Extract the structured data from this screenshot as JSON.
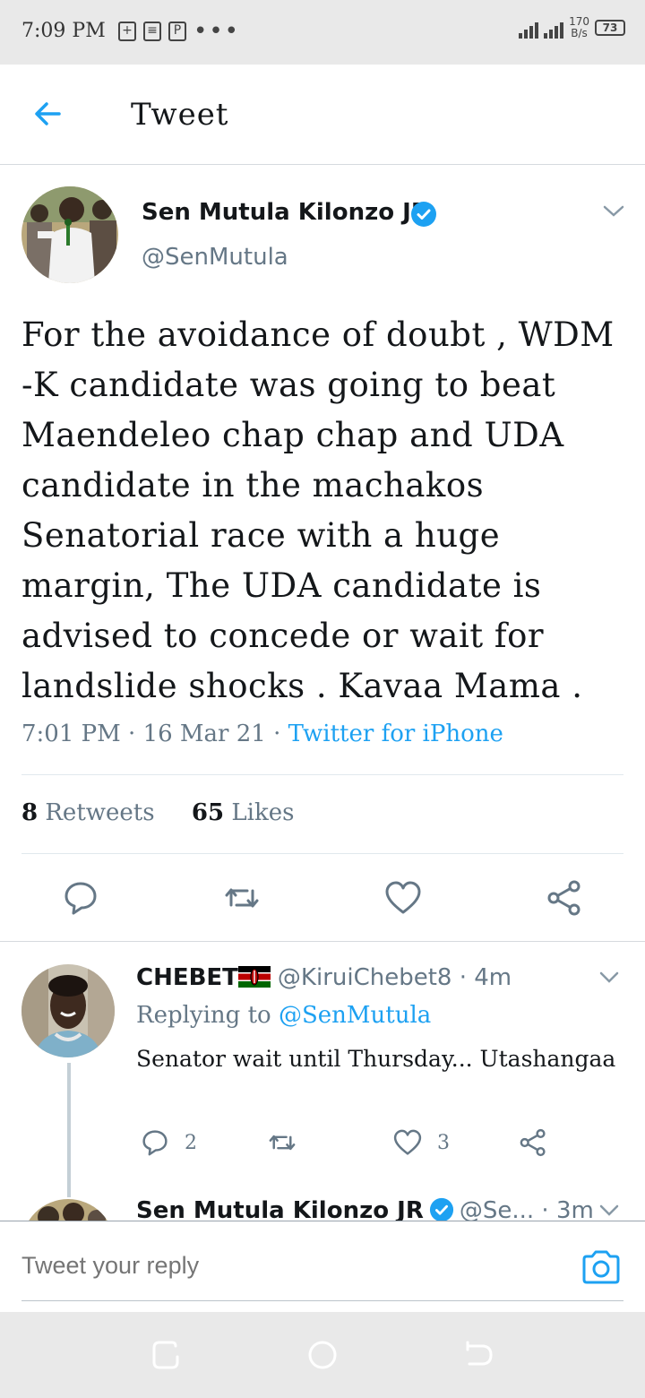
{
  "status_bar": {
    "time": "7:09 PM",
    "notification_icons": [
      "plus-box-icon",
      "message-icon",
      "pdf-icon"
    ],
    "more": "•••",
    "network_speed_value": "170",
    "network_speed_unit": "B/s",
    "battery_level": "73"
  },
  "header": {
    "back_icon": "arrow-left-icon",
    "title": "Tweet"
  },
  "tweet": {
    "author_name": "Sen Mutula Kilonzo JR",
    "verified": true,
    "handle": "@SenMutula",
    "text": "For the avoidance of doubt , WDM -K candidate was going to beat Maendeleo chap chap and UDA candidate in the machakos Senatorial race with a huge margin, The UDA candidate is advised to concede or wait for landslide shocks . Kavaa Mama .",
    "time": "7:01 PM",
    "dot1": " · ",
    "date": "16 Mar 21",
    "dot2": " · ",
    "source": "Twitter for iPhone",
    "retweets_count": "8",
    "retweets_label": "Retweets",
    "likes_count": "65",
    "likes_label": "Likes",
    "actions": [
      "reply-icon",
      "retweet-icon",
      "like-icon",
      "share-icon"
    ]
  },
  "replies": [
    {
      "author_name": "CHEBET",
      "flag": "kenya-flag-icon",
      "handle": "@KiruiChebet8",
      "sep": " · ",
      "time": "4m",
      "replying_prefix": "Replying to",
      "replying_to": "@SenMutula",
      "text": "Senator wait until Thursday... Utashangaa",
      "reply_count": "2",
      "like_count": "3"
    },
    {
      "author_name": "Sen Mutula Kilonzo JR",
      "handle": "@Se...",
      "sep": " · ",
      "time": "3m"
    }
  ],
  "composer": {
    "placeholder": "Tweet your reply",
    "camera_icon": "camera-icon"
  },
  "colors": {
    "accent": "#1da1f2",
    "text": "#14171a",
    "muted": "#657786",
    "status_bar_bg": "#e9e9e9"
  }
}
